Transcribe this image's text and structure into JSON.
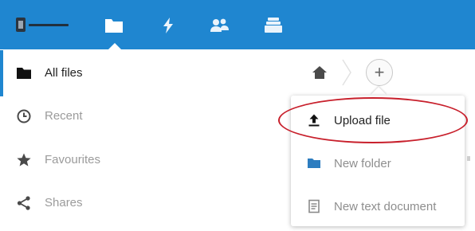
{
  "header": {
    "background": "#1f86d0",
    "nav": [
      {
        "icon": "folder-icon",
        "active": true
      },
      {
        "icon": "lightning-icon",
        "active": false
      },
      {
        "icon": "contacts-icon",
        "active": false
      },
      {
        "icon": "gallery-icon",
        "active": false
      }
    ]
  },
  "sidebar": {
    "items": [
      {
        "label": "All files",
        "icon": "folder-icon",
        "active": true
      },
      {
        "label": "Recent",
        "icon": "clock-icon",
        "active": false
      },
      {
        "label": "Favourites",
        "icon": "star-icon",
        "active": false
      },
      {
        "label": "Shares",
        "icon": "share-icon",
        "active": false
      }
    ]
  },
  "toolbar": {
    "home_icon": "home-icon",
    "new_button_glyph": "+"
  },
  "new_menu": {
    "items": [
      {
        "label": "Upload file",
        "icon": "upload-icon",
        "highlighted": true
      },
      {
        "label": "New folder",
        "icon": "folder-icon"
      },
      {
        "label": "New text document",
        "icon": "document-icon"
      }
    ],
    "highlight_color": "#c8202c"
  }
}
